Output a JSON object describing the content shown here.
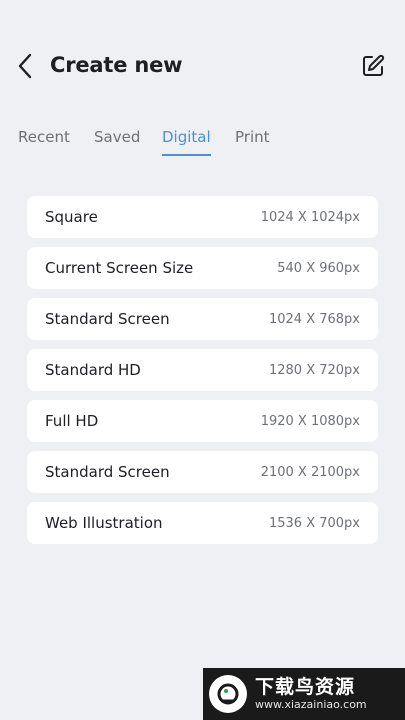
{
  "header": {
    "title": "Create new",
    "back_icon": "chevron-left-icon",
    "edit_icon": "edit-square-icon"
  },
  "tabs": [
    {
      "label": "Recent",
      "active": false
    },
    {
      "label": "Saved",
      "active": false
    },
    {
      "label": "Digital",
      "active": true
    },
    {
      "label": "Print",
      "active": false
    }
  ],
  "presets": [
    {
      "name": "Square",
      "size": "1024 X 1024px"
    },
    {
      "name": "Current Screen Size",
      "size": "540 X 960px"
    },
    {
      "name": "Standard Screen",
      "size": "1024 X 768px"
    },
    {
      "name": "Standard HD",
      "size": "1280 X 720px"
    },
    {
      "name": "Full HD",
      "size": "1920 X 1080px"
    },
    {
      "name": "Standard Screen",
      "size": "2100 X 2100px"
    },
    {
      "name": "Web Illustration",
      "size": "1536 X 700px"
    }
  ],
  "watermark": {
    "text": "下载鸟资源",
    "url": "www.xiazainiao.com"
  },
  "colors": {
    "background": "#eff0f3",
    "accent": "#4a90d9",
    "card": "#ffffff"
  }
}
